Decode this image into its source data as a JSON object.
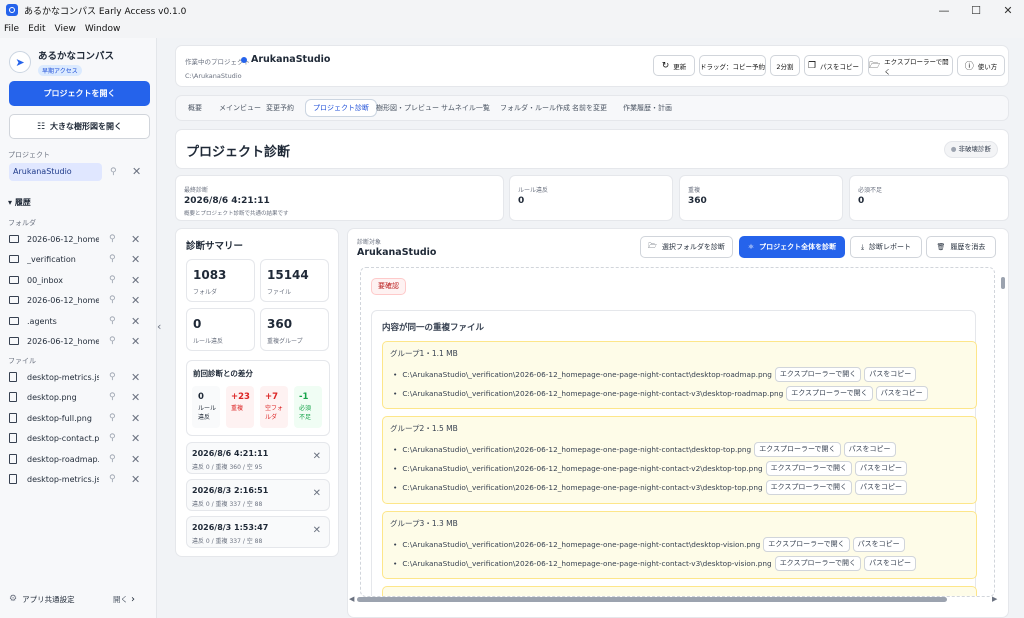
{
  "window": {
    "title": "あるかなコンパス Early Access v0.1.0"
  },
  "menu": [
    "File",
    "Edit",
    "View",
    "Window"
  ],
  "sidebar": {
    "app_name": "あるかなコンパス",
    "badge": "早期アクセス",
    "open_project": "プロジェクトを開く",
    "open_tree": "大きな樹形図を開く",
    "project_label": "プロジェクト",
    "project_item": "ArukanaStudio",
    "history_label": "履歴",
    "folders_label": "フォルダ",
    "files_label": "ファイル",
    "folders": [
      "2026-06-12_home...",
      "_verification",
      "00_inbox",
      "2026-06-12_home...",
      ".agents",
      "2026-06-12_home..."
    ],
    "files": [
      "desktop-metrics.js...",
      "desktop.png",
      "desktop-full.png",
      "desktop-contact.p...",
      "desktop-roadmap...",
      "desktop-metrics.js..."
    ],
    "footer_label": "アプリ共通設定",
    "footer_open": "開く"
  },
  "header": {
    "current_label": "作業中のプロジェクト",
    "project": "ArukanaStudio",
    "path": "C:\\ArukanaStudio",
    "buttons": [
      "更新",
      "ドラッグ：コピー予約",
      "2分割",
      "パスをコピー",
      "エクスプローラーで開く",
      "使い方"
    ]
  },
  "tabs": [
    "概要",
    "メインビュー",
    "変更予約",
    "プロジェクト診断",
    "樹形図・プレビュー",
    "サムネイル一覧",
    "フォルダ・ルール作成",
    "名前を変更",
    "作業履歴・計画"
  ],
  "page": {
    "title": "プロジェクト診断",
    "chip": "非破壊診断"
  },
  "stats": [
    {
      "label": "最終診断",
      "value": "2026/8/6 4:21:11",
      "sub": "概要とプロジェクト診断で共通の結果です"
    },
    {
      "label": "ルール違反",
      "value": "0"
    },
    {
      "label": "重複",
      "value": "360"
    },
    {
      "label": "必須不足",
      "value": "0"
    }
  ],
  "summary": {
    "title": "診断サマリー",
    "metrics": [
      {
        "v": "1083",
        "l": "フォルダ"
      },
      {
        "v": "15144",
        "l": "ファイル"
      },
      {
        "v": "0",
        "l": "ルール違反"
      },
      {
        "v": "360",
        "l": "重複グループ"
      }
    ],
    "diff_title": "前回診断との差分",
    "diff": [
      {
        "v": "0",
        "l": "ルール 違反"
      },
      {
        "v": "+23",
        "l": "重複"
      },
      {
        "v": "+7",
        "l": "空フォ ルダ"
      },
      {
        "v": "-1",
        "l": "必須 不足"
      }
    ],
    "history": [
      {
        "d": "2026/8/6 4:21:11",
        "s": "違反 0 / 重複 360 / 空 95"
      },
      {
        "d": "2026/8/3 2:16:51",
        "s": "違反 0 / 重複 337 / 空 88"
      },
      {
        "d": "2026/8/3 1:53:47",
        "s": "違反 0 / 重複 337 / 空 88"
      }
    ]
  },
  "target": {
    "label": "診断対象",
    "name": "ArukanaStudio",
    "buttons": [
      "選択フォルダを診断",
      "プロジェクト全体を診断",
      "診断レポート",
      "履歴を消去"
    ]
  },
  "result": {
    "status": "要確認",
    "section_title": "内容が同一の重複ファイル",
    "btn_explorer": "エクスプローラーで開く",
    "btn_copy": "パスをコピー",
    "groups": [
      {
        "title": "グループ1・1.1 MB",
        "files": [
          "C:\\ArukanaStudio\\_verification\\2026-06-12_homepage-one-page-night-contact\\desktop-roadmap.png",
          "C:\\ArukanaStudio\\_verification\\2026-06-12_homepage-one-page-night-contact-v3\\desktop-roadmap.png"
        ]
      },
      {
        "title": "グループ2・1.5 MB",
        "files": [
          "C:\\ArukanaStudio\\_verification\\2026-06-12_homepage-one-page-night-contact\\desktop-top.png",
          "C:\\ArukanaStudio\\_verification\\2026-06-12_homepage-one-page-night-contact-v2\\desktop-top.png",
          "C:\\ArukanaStudio\\_verification\\2026-06-12_homepage-one-page-night-contact-v3\\desktop-top.png"
        ]
      },
      {
        "title": "グループ3・1.3 MB",
        "files": [
          "C:\\ArukanaStudio\\_verification\\2026-06-12_homepage-one-page-night-contact\\desktop-vision.png",
          "C:\\ArukanaStudio\\_verification\\2026-06-12_homepage-one-page-night-contact-v3\\desktop-vision.png"
        ]
      }
    ]
  },
  "colors": {
    "accent": "#2563eb",
    "group_bg": "#fefce8",
    "alert": "#dc2626",
    "success": "#16a34a"
  }
}
